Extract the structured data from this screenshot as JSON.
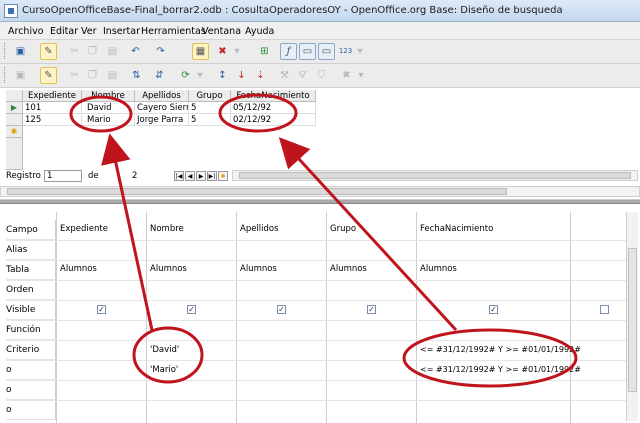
{
  "window": {
    "title": "CursoOpenOfficeBase-Final_borrar2.odb : CosultaOperadoresOY - OpenOffice.org Base: Diseño de busqueda"
  },
  "menubar": {
    "items": [
      "Archivo",
      "Editar",
      "Ver",
      "Insertar",
      "Herramientas",
      "Ventana",
      "Ayuda"
    ]
  },
  "toolbar1": {
    "icons": [
      "save-icon",
      "edit-icon",
      "cut-icon",
      "copy-icon",
      "paste-icon",
      "undo-icon",
      "redo-icon",
      "design-view-icon",
      "delete-icon",
      "add-tables-icon",
      "functions-icon",
      "table-name-icon",
      "alias-icon",
      "distinct-values-icon"
    ]
  },
  "toolbar2": {
    "icons": [
      "save-icon",
      "edit-icon",
      "cut-icon",
      "copy-icon",
      "paste-icon",
      "sort-asc-icon",
      "sort-desc-icon",
      "autofilter-icon",
      "refresh-icon",
      "filter-icon",
      "standard-filter-icon",
      "remove-filter-icon",
      "delete-record-icon"
    ]
  },
  "results": {
    "columns": [
      "Expediente",
      "Nombre",
      "Apellidos",
      "Grupo",
      "FechaNacimiento"
    ],
    "rows": [
      [
        "101",
        "David",
        "Cayero Sierra",
        "5",
        "05/12/92"
      ],
      [
        "125",
        "Mario",
        "Jorge Parra",
        "5",
        "02/12/92"
      ]
    ],
    "current_row_marker": "▶",
    "new_row_marker": "✱"
  },
  "navigation": {
    "registro_label": "Registro",
    "registro_value": "1",
    "de_label": "de",
    "total": "2"
  },
  "design": {
    "row_labels": [
      "Campo",
      "Alias",
      "Tabla",
      "Orden",
      "Visible",
      "Función",
      "Criterio",
      "o",
      "o",
      "o"
    ],
    "fields": [
      "Expediente",
      "Nombre",
      "Apellidos",
      "Grupo",
      "FechaNacimiento",
      ""
    ],
    "tables": [
      "Alumnos",
      "Alumnos",
      "Alumnos",
      "Alumnos",
      "Alumnos",
      ""
    ],
    "visible": [
      true,
      true,
      true,
      true,
      true,
      false
    ],
    "criteria": {
      "nombre_criterio": "'David'",
      "nombre_o": "'Mario'",
      "fecha_criterio": "<= #31/12/1992# Y >= #01/01/1992#",
      "fecha_o": "<= #31/12/1992# Y >= #01/01/1992#"
    }
  },
  "annotations": {
    "color": "#c0141c"
  },
  "colors": {
    "titlebar": "#c4d8ee",
    "toolbar": "#ececec",
    "splitter": "#a9a9a9"
  }
}
